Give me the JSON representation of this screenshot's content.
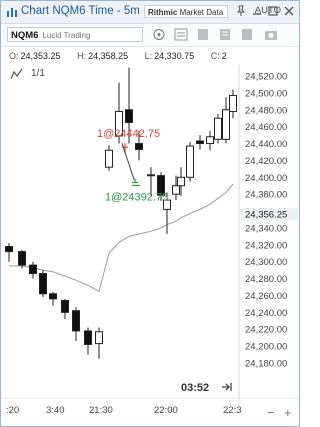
{
  "window": {
    "title": "Chart NQM6 Time - 5m",
    "brand_bold": "Rithmic",
    "brand_rest": " Market Data"
  },
  "toolbar": {
    "symbol": "NQM6",
    "account": "Lucid Trading",
    "scale_mode": "AUTO"
  },
  "ohlc": {
    "open_label": "O:",
    "open": "24,353.25",
    "high_label": "H:",
    "high": "24,358.25",
    "low_label": "L:",
    "low": "24,330.75",
    "close_label": "C:",
    "close": "2"
  },
  "tools": {
    "ratio": "1/1"
  },
  "clock": "03:52",
  "chart_data": {
    "type": "candlestick",
    "y_axis": {
      "ticks": [
        "24,520.00",
        "24,500.00",
        "24,480.00",
        "24,460.00",
        "24,440.00",
        "24,420.00",
        "24,400.00",
        "24,380.00",
        "24,360.00",
        "24,340.00",
        "24,320.00",
        "24,300.00",
        "24,280.00",
        "24,260.00",
        "24,240.00",
        "24,220.00",
        "24,200.00",
        "24,180.00"
      ],
      "current_price": "24,356.25",
      "range": [
        24175,
        24530
      ]
    },
    "x_axis": {
      "ticks": [
        ":20",
        "3:40",
        "21:30",
        "22:00",
        "22:3"
      ]
    },
    "candles": [
      {
        "o": 24318,
        "h": 24322,
        "l": 24300,
        "c": 24312
      },
      {
        "o": 24312,
        "h": 24314,
        "l": 24292,
        "c": 24296
      },
      {
        "o": 24296,
        "h": 24300,
        "l": 24280,
        "c": 24286
      },
      {
        "o": 24286,
        "h": 24290,
        "l": 24258,
        "c": 24262
      },
      {
        "o": 24262,
        "h": 24264,
        "l": 24248,
        "c": 24256
      },
      {
        "o": 24254,
        "h": 24256,
        "l": 24232,
        "c": 24240
      },
      {
        "o": 24242,
        "h": 24246,
        "l": 24206,
        "c": 24218
      },
      {
        "o": 24218,
        "h": 24222,
        "l": 24190,
        "c": 24202
      },
      {
        "o": 24203,
        "h": 24222,
        "l": 24185,
        "c": 24217
      },
      {
        "o": 24412,
        "h": 24438,
        "l": 24408,
        "c": 24432
      },
      {
        "o": 24449,
        "h": 24512,
        "l": 24440,
        "c": 24478
      },
      {
        "o": 24480,
        "h": 24530,
        "l": 24440,
        "c": 24465
      },
      {
        "o": 24440,
        "h": 24455,
        "l": 24420,
        "c": 24433
      },
      {
        "o": 24403,
        "h": 24412,
        "l": 24378,
        "c": 24402
      },
      {
        "o": 24402,
        "h": 24406,
        "l": 24372,
        "c": 24379
      },
      {
        "o": 24362,
        "h": 24382,
        "l": 24333,
        "c": 24373
      },
      {
        "o": 24380,
        "h": 24402,
        "l": 24373,
        "c": 24390
      },
      {
        "o": 24390,
        "h": 24412,
        "l": 24378,
        "c": 24400
      },
      {
        "o": 24400,
        "h": 24442,
        "l": 24395,
        "c": 24437
      },
      {
        "o": 24443,
        "h": 24450,
        "l": 24433,
        "c": 24440
      },
      {
        "o": 24440,
        "h": 24455,
        "l": 24432,
        "c": 24448
      },
      {
        "o": 24445,
        "h": 24475,
        "l": 24440,
        "c": 24470
      },
      {
        "o": 24445,
        "h": 24495,
        "l": 24440,
        "c": 24480
      },
      {
        "o": 24478,
        "h": 24504,
        "l": 24470,
        "c": 24497
      }
    ],
    "moving_average": [
      24295,
      24295,
      24293,
      24290,
      24288,
      24283,
      24278,
      24272,
      24265,
      24310,
      24323,
      24330,
      24333,
      24336,
      24340,
      24344,
      24348,
      24352,
      24357,
      24362,
      24368,
      24375,
      24382,
      24392
    ],
    "fills": [
      {
        "label": "1@24442.75",
        "price": 24442.75,
        "side": "sell",
        "color": "#e0413a"
      },
      {
        "label": "1@24392.75",
        "price": 24392.75,
        "side": "buy",
        "color": "#2e9a4a"
      }
    ]
  }
}
